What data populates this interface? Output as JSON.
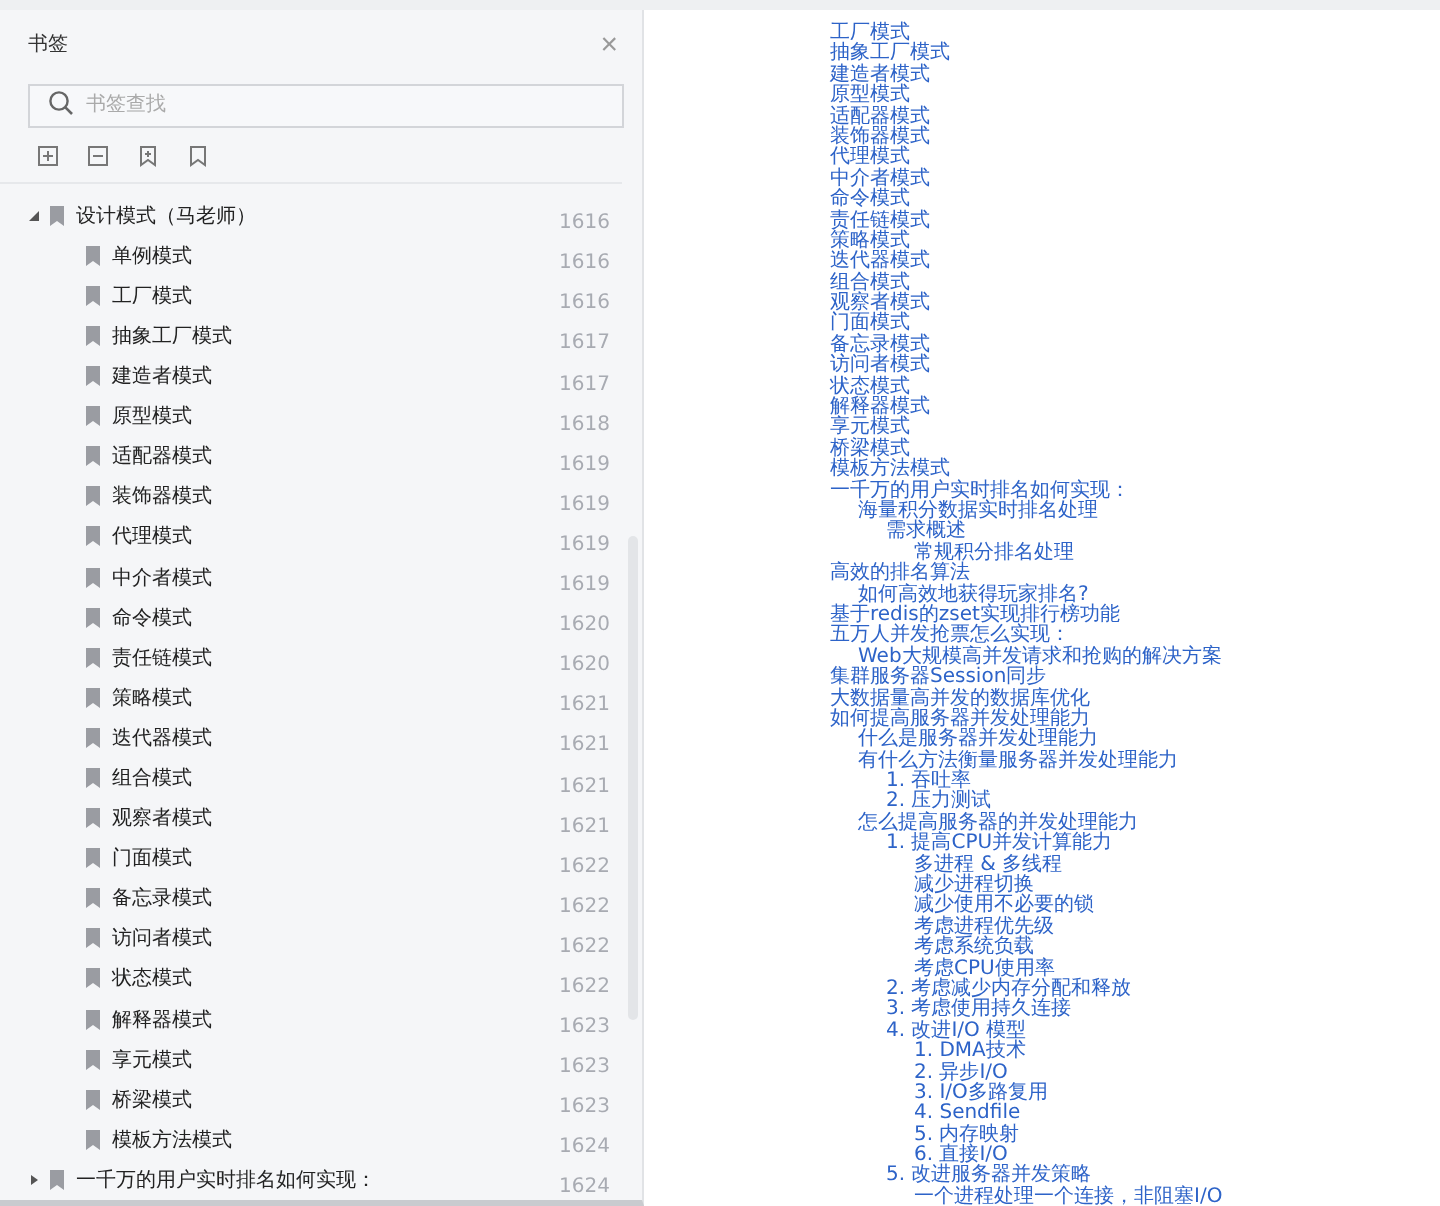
{
  "bookmark_panel": {
    "title": "书签",
    "close": "×",
    "search": {
      "placeholder": "书签查找"
    },
    "tree": [
      {
        "label": "设计模式（马老师）",
        "page": "1616",
        "expanded": true,
        "children": [
          {
            "label": "单例模式",
            "page": "1616"
          },
          {
            "label": "工厂模式",
            "page": "1616"
          },
          {
            "label": "抽象工厂模式",
            "page": "1617"
          },
          {
            "label": "建造者模式",
            "page": "1617"
          },
          {
            "label": "原型模式",
            "page": "1618"
          },
          {
            "label": "适配器模式",
            "page": "1619"
          },
          {
            "label": "装饰器模式",
            "page": "1619"
          },
          {
            "label": "代理模式",
            "page": "1619"
          },
          {
            "label": "中介者模式",
            "page": "1619"
          },
          {
            "label": "命令模式",
            "page": "1620"
          },
          {
            "label": "责任链模式",
            "page": "1620"
          },
          {
            "label": "策略模式",
            "page": "1621"
          },
          {
            "label": "迭代器模式",
            "page": "1621"
          },
          {
            "label": "组合模式",
            "page": "1621"
          },
          {
            "label": "观察者模式",
            "page": "1621"
          },
          {
            "label": "门面模式",
            "page": "1622"
          },
          {
            "label": "备忘录模式",
            "page": "1622"
          },
          {
            "label": "访问者模式",
            "page": "1622"
          },
          {
            "label": "状态模式",
            "page": "1622"
          },
          {
            "label": "解释器模式",
            "page": "1623"
          },
          {
            "label": "享元模式",
            "page": "1623"
          },
          {
            "label": "桥梁模式",
            "page": "1623"
          },
          {
            "label": "模板方法模式",
            "page": "1624"
          }
        ]
      },
      {
        "label": "一千万的用户实时排名如何实现：",
        "page": "1624",
        "expanded": false
      }
    ]
  },
  "document": {
    "outline": [
      {
        "text": "工厂模式"
      },
      {
        "text": "抽象工厂模式"
      },
      {
        "text": "建造者模式"
      },
      {
        "text": "原型模式"
      },
      {
        "text": "适配器模式"
      },
      {
        "text": "装饰器模式"
      },
      {
        "text": "代理模式"
      },
      {
        "text": "中介者模式"
      },
      {
        "text": "命令模式"
      },
      {
        "text": "责任链模式"
      },
      {
        "text": "策略模式"
      },
      {
        "text": "迭代器模式"
      },
      {
        "text": "组合模式"
      },
      {
        "text": "观察者模式"
      },
      {
        "text": "门面模式"
      },
      {
        "text": "备忘录模式"
      },
      {
        "text": "访问者模式"
      },
      {
        "text": "状态模式"
      },
      {
        "text": "解释器模式"
      },
      {
        "text": "享元模式"
      },
      {
        "text": "桥梁模式"
      },
      {
        "text": "模板方法模式"
      },
      {
        "text": "一千万的用户实时排名如何实现：",
        "children": [
          {
            "text": "海量积分数据实时排名处理",
            "children": [
              {
                "text": "需求概述",
                "children": [
                  {
                    "text": "常规积分排名处理"
                  }
                ]
              }
            ]
          }
        ]
      },
      {
        "text": "高效的排名算法",
        "children": [
          {
            "text": "如何高效地获得玩家排名?"
          }
        ]
      },
      {
        "text": "基于redis的zset实现排行榜功能"
      },
      {
        "text": "五万人并发抢票怎么实现：",
        "children": [
          {
            "text": "Web大规模高并发请求和抢购的解决方案"
          }
        ]
      },
      {
        "text": "集群服务器Session同步"
      },
      {
        "text": "大数据量高并发的数据库优化"
      },
      {
        "text": "如何提高服务器并发处理能力",
        "children": [
          {
            "text": "什么是服务器并发处理能力"
          },
          {
            "text": "有什么方法衡量服务器并发处理能力",
            "children": [
              {
                "text": "1. 吞吐率"
              },
              {
                "text": "2. 压力测试"
              }
            ]
          },
          {
            "text": "怎么提高服务器的并发处理能力",
            "children": [
              {
                "text": "1. 提高CPU并发计算能力",
                "children": [
                  {
                    "text": "多进程 & 多线程"
                  },
                  {
                    "text": "减少进程切换"
                  },
                  {
                    "text": "减少使用不必要的锁"
                  },
                  {
                    "text": "考虑进程优先级"
                  },
                  {
                    "text": "考虑系统负载"
                  },
                  {
                    "text": "考虑CPU使用率"
                  }
                ]
              },
              {
                "text": "2. 考虑减少内存分配和释放"
              },
              {
                "text": "3. 考虑使用持久连接"
              },
              {
                "text": "4. 改进I/O 模型",
                "children": [
                  {
                    "text": "1. DMA技术"
                  },
                  {
                    "text": "2. 异步I/O"
                  },
                  {
                    "text": "3. I/O多路复用"
                  },
                  {
                    "text": "4. Sendfile"
                  },
                  {
                    "text": "5. 内存映射"
                  },
                  {
                    "text": "6. 直接I/O"
                  }
                ]
              },
              {
                "text": "5. 改进服务器并发策略",
                "children": [
                  {
                    "text": "一个进程处理一个连接，非阻塞I/O"
                  }
                ]
              }
            ]
          }
        ]
      }
    ]
  }
}
